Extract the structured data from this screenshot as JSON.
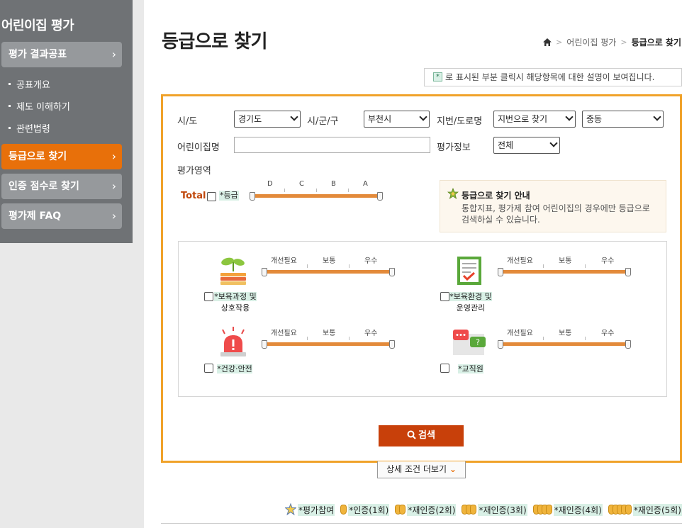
{
  "sidebar": {
    "title": "어린이집 평가",
    "items": [
      {
        "label": "평가 결과공표"
      },
      {
        "label": "등급으로 찾기"
      },
      {
        "label": "인증 점수로 찾기"
      },
      {
        "label": "평가제 FAQ"
      }
    ],
    "subitems": [
      "공표개요",
      "제도 이해하기",
      "관련법령"
    ],
    "chevron": "›"
  },
  "header": {
    "title": "등급으로 찾기",
    "breadcrumb": [
      "어린이집 평가",
      "등급으로 찾기"
    ]
  },
  "note": {
    "mark": "*",
    "text": "로 표시된 부분 클릭시 해당항목에 대한 설명이 보여집니다."
  },
  "form": {
    "sido_label": "시/도",
    "sido_value": "경기도",
    "sigungu_label": "시/군/구",
    "sigungu_value": "부천시",
    "address_label": "지번/도로명",
    "address_value": "지번으로 찾기",
    "dong_value": "중동",
    "name_label": "어린이집명",
    "name_value": "",
    "eval_label": "평가정보",
    "eval_value": "전체",
    "area_label": "평가영역"
  },
  "total": {
    "label": "Total",
    "tag": "*등급",
    "ticks": [
      "D",
      "C",
      "B",
      "A"
    ]
  },
  "guide": {
    "title": "등급으로 찾기 안내",
    "text": "통합지표, 평가제 참여 어린이집의 경우에만 등급으로 검색하실 수 있습니다."
  },
  "areas": {
    "ticks": [
      "개선필요",
      "보통",
      "우수"
    ],
    "items": [
      {
        "label_line1": "*보육과정 및",
        "label_line2": "상호작용",
        "icon": "sprout-book-icon"
      },
      {
        "label_line1": "*보육환경 및",
        "label_line2": "운영관리",
        "icon": "checklist-board-icon"
      },
      {
        "label_line1": "*건강·안전",
        "label_line2": "",
        "icon": "siren-icon"
      },
      {
        "label_line1": "*교직원",
        "label_line2": "",
        "icon": "speech-bubbles-icon"
      }
    ]
  },
  "buttons": {
    "search": "검색",
    "more": "상세 조건 더보기"
  },
  "legend": [
    {
      "label": "*평가참여",
      "medals": 0
    },
    {
      "label": "*인증(1회)",
      "medals": 1
    },
    {
      "label": "*재인증(2회)",
      "medals": 2
    },
    {
      "label": "*재인증(3회)",
      "medals": 3
    },
    {
      "label": "*재인증(4회)",
      "medals": 4
    },
    {
      "label": "*재인증(5회)",
      "medals": 5
    }
  ],
  "colors": {
    "accent": "#e8700a",
    "frame": "#f0a22a",
    "search_button": "#c8400a",
    "sidebar": "#6f7275"
  }
}
